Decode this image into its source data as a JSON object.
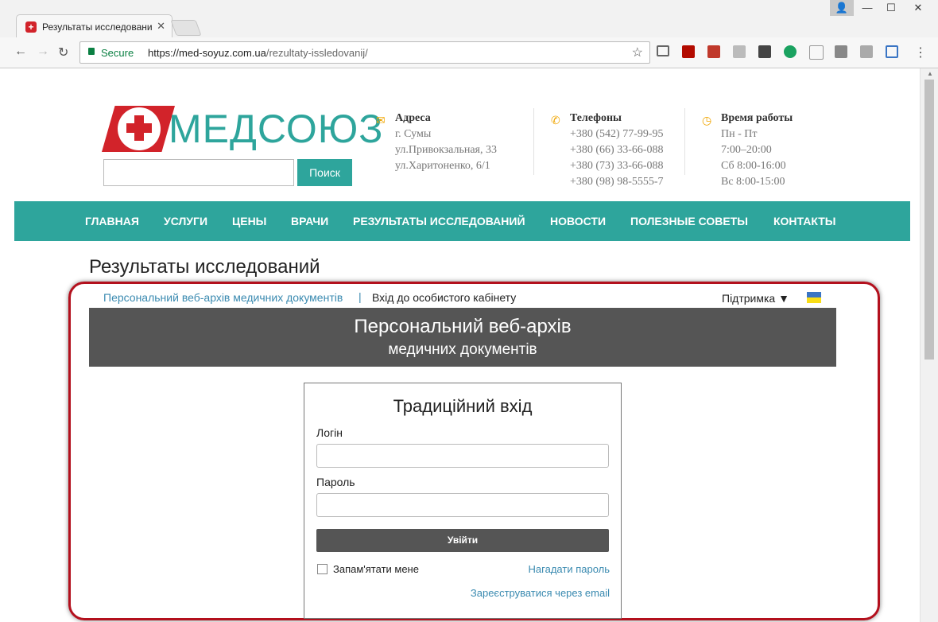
{
  "browser": {
    "tab_title": "Результаты исследовани",
    "secure_label": "Secure",
    "url_host": "https://med-soyuz.com.ua",
    "url_path": "/rezultaty-issledovanij/"
  },
  "header": {
    "logo_text": "МЕДСОЮЗ",
    "search_button": "Поиск",
    "address": {
      "title": "Адреса",
      "lines": [
        "г. Сумы",
        "ул.Привокзальная, 33",
        "ул.Харитоненко, 6/1"
      ]
    },
    "phones": {
      "title": "Телефоны",
      "lines": [
        "+380 (542) 77-99-95",
        "+380 (66) 33-66-088",
        "+380 (73) 33-66-088",
        "+380 (98) 98-5555-7"
      ]
    },
    "hours": {
      "title": "Время работы",
      "lines": [
        "Пн - Пт",
        "7:00–20:00",
        "Сб 8:00-16:00",
        "Вс 8:00-15:00"
      ]
    }
  },
  "nav": [
    "ГЛАВНАЯ",
    "УСЛУГИ",
    "ЦЕНЫ",
    "ВРАЧИ",
    "РЕЗУЛЬТАТЫ ИССЛЕДОВАНИЙ",
    "НОВОСТИ",
    "ПОЛЕЗНЫЕ СОВЕТЫ",
    "КОНТАКТЫ"
  ],
  "page_title": "Результаты исследований",
  "portal": {
    "subnav_archive": "Персональний веб-архів медичних документів",
    "subnav_sep": "|",
    "subnav_cabinet": "Вхід до особистого кабінету",
    "support": "Підтримка",
    "banner_line1": "Персональний веб-архів",
    "banner_line2": "медичних документів",
    "login": {
      "title": "Традиційний вхід",
      "login_label": "Логін",
      "password_label": "Пароль",
      "submit": "Увійти",
      "remember": "Запам'ятати мене",
      "forgot": "Нагадати пароль",
      "register": "Зареєструватися через email"
    }
  },
  "colors": {
    "brand_teal": "#2ea59c",
    "brand_red": "#d2232a",
    "frame_red": "#b3101d"
  }
}
